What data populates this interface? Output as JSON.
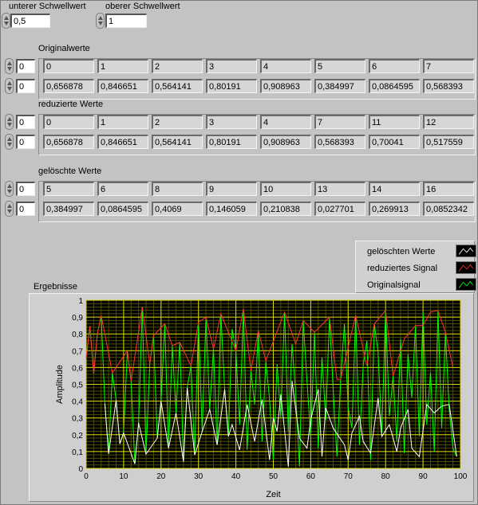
{
  "controls": {
    "lower_threshold": {
      "label": "unterer Schwellwert",
      "value": "0,5"
    },
    "upper_threshold": {
      "label": "oberer Schwellwert",
      "value": "1"
    }
  },
  "arrays": [
    {
      "title": "Originalwerte",
      "index_top": "0",
      "index_bottom": "0",
      "indices": [
        "0",
        "1",
        "2",
        "3",
        "4",
        "5",
        "6",
        "7"
      ],
      "values": [
        "0,656878",
        "0,846651",
        "0,564141",
        "0,80191",
        "0,908963",
        "0,384997",
        "0,0864595",
        "0,568393"
      ]
    },
    {
      "title": "reduzierte Werte",
      "index_top": "0",
      "index_bottom": "0",
      "indices": [
        "0",
        "1",
        "2",
        "3",
        "4",
        "7",
        "11",
        "12"
      ],
      "values": [
        "0,656878",
        "0,846651",
        "0,564141",
        "0,80191",
        "0,908963",
        "0,568393",
        "0,70041",
        "0,517559"
      ]
    },
    {
      "title": "gelöschte Werte",
      "index_top": "0",
      "index_bottom": "0",
      "indices": [
        "5",
        "6",
        "8",
        "9",
        "10",
        "13",
        "14",
        "16"
      ],
      "values": [
        "0,384997",
        "0,0864595",
        "0,4069",
        "0,146059",
        "0,210838",
        "0,027701",
        "0,269913",
        "0,0852342"
      ]
    }
  ],
  "legend": [
    {
      "label": "gelöschten Werte",
      "color": "#ffffff"
    },
    {
      "label": "reduziertes Signal",
      "color": "#ff3333"
    },
    {
      "label": "Originalsignal",
      "color": "#00ff00"
    }
  ],
  "chart_data": {
    "type": "line",
    "title": "Ergebnisse",
    "xlabel": "Zeit",
    "ylabel": "Amplitude",
    "xlim": [
      0,
      100
    ],
    "ylim": [
      0,
      1
    ],
    "x_ticks": [
      "0",
      "10",
      "20",
      "30",
      "40",
      "50",
      "60",
      "70",
      "80",
      "90",
      "100"
    ],
    "y_ticks": [
      "0",
      "0,1",
      "0,2",
      "0,3",
      "0,4",
      "0,5",
      "0,6",
      "0,7",
      "0,8",
      "0,9",
      "1"
    ],
    "grid": true,
    "plot_background": "#000000",
    "grid_color": "#d6d600",
    "series": [
      {
        "name": "Originalsignal",
        "color": "#00ff00",
        "x": [
          0,
          1,
          2,
          3,
          4,
          5,
          6,
          7,
          8,
          9,
          10,
          11,
          12,
          13,
          14,
          15,
          16,
          17,
          18,
          19,
          20,
          21,
          22,
          23,
          24,
          25,
          26,
          27,
          28,
          29,
          30,
          31,
          32,
          33,
          34,
          35,
          36,
          37,
          38,
          39,
          40,
          41,
          42,
          43,
          44,
          45,
          46,
          47,
          48,
          49,
          50,
          51,
          52,
          53,
          54,
          55,
          56,
          57,
          58,
          59,
          60,
          61,
          62,
          63,
          64,
          65,
          66,
          67,
          68,
          69,
          70,
          71,
          72,
          73,
          74,
          75,
          76,
          77,
          78,
          79,
          80,
          81,
          82,
          83,
          84,
          85,
          86,
          87,
          88,
          89,
          90,
          91,
          92,
          93,
          94,
          95,
          96,
          97,
          98,
          99
        ],
        "y": [
          0.657,
          0.847,
          0.564,
          0.802,
          0.909,
          0.385,
          0.086,
          0.568,
          0.407,
          0.146,
          0.211,
          0.7,
          0.518,
          0.027,
          0.27,
          0.96,
          0.085,
          0.62,
          0.79,
          0.18,
          0.4,
          0.86,
          0.12,
          0.73,
          0.33,
          0.75,
          0.04,
          0.48,
          0.61,
          0.08,
          0.87,
          0.22,
          0.9,
          0.35,
          0.71,
          0.14,
          0.92,
          0.47,
          0.19,
          0.83,
          0.7,
          0.26,
          0.95,
          0.11,
          0.58,
          0.38,
          0.82,
          0.16,
          0.64,
          0.41,
          0.05,
          0.62,
          0.3,
          0.93,
          0.22,
          0.74,
          0.44,
          0.01,
          0.88,
          0.52,
          0.18,
          0.81,
          0.12,
          0.66,
          0.29,
          0.9,
          0.47,
          0.07,
          0.53,
          0.86,
          0.36,
          0.24,
          0.91,
          0.14,
          0.61,
          0.76,
          0.05,
          0.86,
          0.69,
          0.21,
          0.94,
          0.31,
          0.55,
          0.16,
          0.77,
          0.09,
          0.68,
          0.42,
          0.85,
          0.19,
          0.93,
          0.26,
          0.57,
          0.1,
          0.94,
          0.24,
          0.81,
          0.35,
          0.12,
          0.07
        ]
      },
      {
        "name": "reduziertes Signal",
        "color": "#ff3333",
        "x": [
          0,
          1,
          2,
          3,
          4,
          7,
          11,
          12,
          15,
          17,
          18,
          21,
          23,
          25,
          28,
          30,
          32,
          34,
          36,
          40,
          42,
          44,
          46,
          48,
          53,
          56,
          58,
          61,
          65,
          67,
          68,
          72,
          75,
          77,
          80,
          82,
          85,
          88,
          90,
          92,
          94,
          96,
          98
        ],
        "y": [
          0.657,
          0.847,
          0.564,
          0.802,
          0.909,
          0.568,
          0.7,
          0.518,
          0.96,
          0.62,
          0.79,
          0.86,
          0.73,
          0.75,
          0.61,
          0.87,
          0.9,
          0.71,
          0.92,
          0.7,
          0.95,
          0.58,
          0.82,
          0.64,
          0.93,
          0.74,
          0.88,
          0.81,
          0.9,
          0.53,
          0.53,
          0.91,
          0.61,
          0.86,
          0.94,
          0.55,
          0.77,
          0.85,
          0.85,
          0.93,
          0.94,
          0.81,
          0.6
        ]
      },
      {
        "name": "gelöschten Werte",
        "color": "#ffffff",
        "x": [
          5,
          6,
          8,
          9,
          10,
          13,
          14,
          16,
          19,
          20,
          22,
          24,
          26,
          27,
          29,
          31,
          33,
          35,
          37,
          38,
          39,
          41,
          43,
          45,
          47,
          49,
          50,
          51,
          52,
          54,
          55,
          57,
          59,
          60,
          62,
          63,
          64,
          66,
          69,
          70,
          71,
          73,
          74,
          76,
          78,
          79,
          81,
          83,
          84,
          86,
          87,
          89,
          91,
          93,
          95,
          97,
          99
        ],
        "y": [
          0.385,
          0.086,
          0.407,
          0.146,
          0.211,
          0.027,
          0.27,
          0.085,
          0.18,
          0.4,
          0.12,
          0.33,
          0.04,
          0.48,
          0.08,
          0.22,
          0.35,
          0.14,
          0.47,
          0.19,
          0.26,
          0.11,
          0.38,
          0.16,
          0.41,
          0.05,
          0.3,
          0.22,
          0.44,
          0.01,
          0.52,
          0.18,
          0.12,
          0.29,
          0.47,
          0.07,
          0.36,
          0.24,
          0.14,
          0.05,
          0.21,
          0.31,
          0.16,
          0.09,
          0.42,
          0.19,
          0.26,
          0.1,
          0.24,
          0.35,
          0.12,
          0.07,
          0.38,
          0.33,
          0.37,
          0.38,
          0.07
        ]
      }
    ]
  }
}
